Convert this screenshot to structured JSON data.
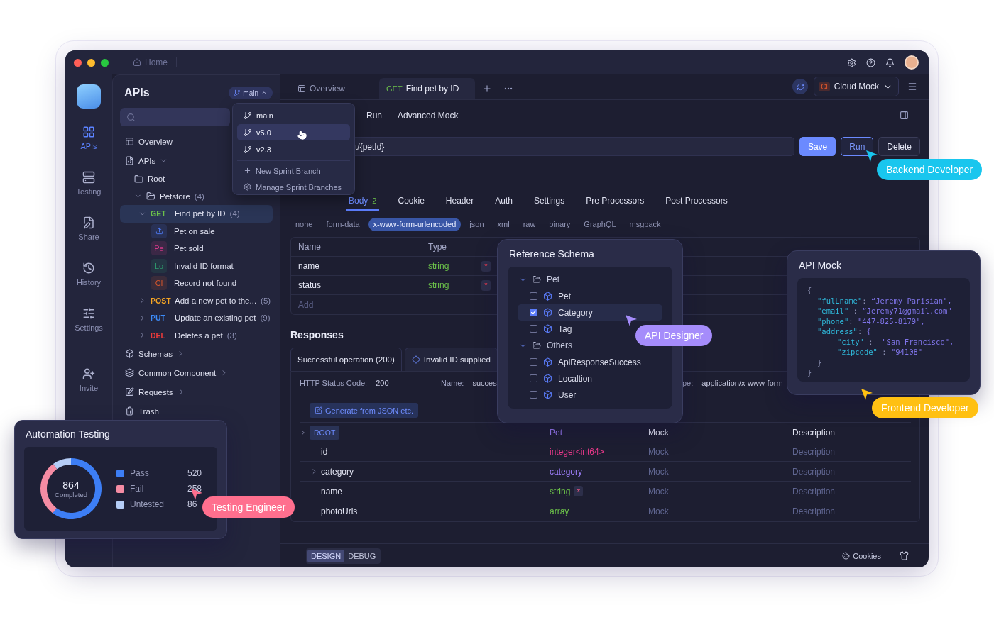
{
  "window": {
    "home": "Home"
  },
  "rail": {
    "items": [
      {
        "label": "APIs",
        "selected": true
      },
      {
        "label": "Testing",
        "selected": false
      },
      {
        "label": "Share",
        "selected": false
      },
      {
        "label": "History",
        "selected": false
      },
      {
        "label": "Settings",
        "selected": false
      }
    ],
    "invite": "Invite"
  },
  "tree": {
    "title": "APIs",
    "branch": {
      "label": "main",
      "expanded": true
    },
    "sections": [
      {
        "kind": "section",
        "label": "Overview"
      },
      {
        "kind": "section",
        "label": "APIs",
        "expanded": true,
        "children": [
          {
            "kind": "folder",
            "label": "Root"
          },
          {
            "kind": "folder",
            "label": "Petstore",
            "count": "(4)",
            "expanded": true,
            "children": [
              {
                "kind": "endpoint",
                "method": "GET",
                "color": "#6cc24a",
                "label": "Find pet by ID",
                "count": "(4)",
                "expanded": true,
                "selected": true,
                "children": [
                  {
                    "kind": "case",
                    "label": "Pet on sale",
                    "color": "#4f7cf7",
                    "selected": false
                  },
                  {
                    "kind": "case",
                    "badge": "Pe",
                    "label": "Pet sold",
                    "color": "#d63a8a",
                    "selected": false
                  },
                  {
                    "kind": "case",
                    "badge": "Lo",
                    "label": "Invalid ID format",
                    "color": "#2f9e6e",
                    "selected": false
                  },
                  {
                    "kind": "case",
                    "badge": "Cl",
                    "label": "Record not found",
                    "color": "#d9572b",
                    "selected": false
                  }
                ]
              },
              {
                "kind": "endpoint",
                "method": "POST",
                "color": "#f5a524",
                "label": "Add a new pet to the...",
                "count": "(5)",
                "expanded": false,
                "selected": false
              },
              {
                "kind": "endpoint",
                "method": "PUT",
                "color": "#3d8bf7",
                "label": "Update an existing pet",
                "count": "(9)",
                "expanded": false,
                "selected": false
              },
              {
                "kind": "endpoint",
                "method": "DEL",
                "color": "#ef3b3b",
                "label": "Deletes a pet",
                "count": "(3)",
                "expanded": false,
                "selected": false
              }
            ]
          }
        ]
      },
      {
        "kind": "section",
        "label": "Schemas",
        "expanded": false
      },
      {
        "kind": "section",
        "label": "Common Component",
        "expanded": false
      },
      {
        "kind": "section",
        "label": "Requests",
        "expanded": false
      },
      {
        "kind": "section",
        "label": "Trash"
      }
    ]
  },
  "branch_menu": {
    "branches": [
      {
        "label": "main",
        "selected": false
      },
      {
        "label": "v5.0",
        "selected": true
      },
      {
        "label": "v2.3",
        "selected": false
      }
    ],
    "actions": [
      "New Sprint Branch",
      "Manage Sprint Branches"
    ]
  },
  "tabs": [
    {
      "label": "Overview",
      "selected": false
    },
    {
      "method": "GET",
      "label": "Find pet by ID",
      "selected": true
    }
  ],
  "environment": {
    "badge": "Cl",
    "label": "Cloud Mock"
  },
  "subtabs": [
    "Run",
    "Advanced Mock"
  ],
  "url": {
    "value": "t/{petId}"
  },
  "actions": [
    {
      "label": "Save",
      "kind": "primary"
    },
    {
      "label": "Run",
      "kind": "outline"
    },
    {
      "label": "Delete",
      "kind": "plain"
    }
  ],
  "request_tabs": [
    {
      "label": "Body",
      "count": "2",
      "selected": true
    },
    {
      "label": "Cookie",
      "selected": false
    },
    {
      "label": "Header",
      "selected": false
    },
    {
      "label": "Auth",
      "selected": false
    },
    {
      "label": "Settings",
      "selected": false
    },
    {
      "label": "Pre Processors",
      "selected": false
    },
    {
      "label": "Post Processors",
      "selected": false
    }
  ],
  "body_types": [
    {
      "label": "none",
      "selected": false
    },
    {
      "label": "form-data",
      "selected": false
    },
    {
      "label": "x-www-form-urlencoded",
      "selected": true
    },
    {
      "label": "json",
      "selected": false
    },
    {
      "label": "xml",
      "selected": false
    },
    {
      "label": "raw",
      "selected": false
    },
    {
      "label": "binary",
      "selected": false
    },
    {
      "label": "GraphQL",
      "selected": false
    },
    {
      "label": "msgpack",
      "selected": false
    }
  ],
  "params": {
    "columns": [
      "Name",
      "Type"
    ],
    "rows": [
      {
        "name": "name",
        "type": "string",
        "required_mark": "*"
      },
      {
        "name": "status",
        "type": "string",
        "required_mark": "*"
      }
    ],
    "add": "Add"
  },
  "responses": {
    "title": "Responses",
    "tabs": [
      {
        "label": "Successful operation (200)",
        "selected": true
      },
      {
        "label": "Invalid ID supplied",
        "selected": false
      }
    ],
    "info": [
      {
        "label": "HTTP Status Code:",
        "value": "200"
      },
      {
        "label": "Name:",
        "value": "succes"
      },
      {
        "label": "pe:",
        "value": "application/x-www-form"
      }
    ],
    "generate": "Generate from JSON etc.",
    "schema": {
      "root": "ROOT",
      "root_type": "Pet",
      "columns": [
        "Mock",
        "Description"
      ],
      "rows": [
        {
          "name": "id",
          "type": "integer<int64>",
          "color": "#e8398a",
          "mock": "Mock",
          "description": "Description"
        },
        {
          "name": "category",
          "type": "category",
          "color": "#9b7cf6",
          "expanded": false,
          "mock": "Mock",
          "description": "Description"
        },
        {
          "name": "name",
          "type": "string",
          "color": "#6cc24a",
          "required_mark": "*",
          "mock": "Mock",
          "description": "Description"
        },
        {
          "name": "photoUrls",
          "type": "array",
          "color": "#6cc24a",
          "mock": "Mock",
          "description": "Description"
        }
      ]
    }
  },
  "bottom": {
    "modes": [
      {
        "label": "DESIGN",
        "selected": true
      },
      {
        "label": "DEBUG",
        "selected": false
      }
    ],
    "cookies": "Cookies"
  },
  "reference_schema": {
    "title": "Reference Schema",
    "groups": [
      {
        "label": "Pet",
        "expanded": true,
        "items": [
          {
            "label": "Pet",
            "checked": false
          },
          {
            "label": "Category",
            "checked": true
          },
          {
            "label": "Tag",
            "checked": false
          }
        ]
      },
      {
        "label": "Others",
        "expanded": true,
        "items": [
          {
            "label": "ApiResponseSuccess",
            "checked": false
          },
          {
            "label": "Localtion",
            "checked": false
          },
          {
            "label": "User",
            "checked": false
          }
        ]
      }
    ]
  },
  "api_mock": {
    "title": "API Mock",
    "open": "{",
    "entries": [
      {
        "key": "\"fulLname\"",
        "sep": ": ",
        "value": "“Jeremy Parisian\","
      },
      {
        "key": "\"email\"",
        "sep": " : ",
        "value": "“Jeremy71@gmail.com\""
      },
      {
        "key": "\"phone\"",
        "sep": ": ",
        "value": "\"447-825-8179\","
      },
      {
        "key": "\"address\"",
        "sep": ": ",
        "value": "{",
        "close": "}",
        "children": [
          {
            "key": "\"city\"",
            "sep": " :  ",
            "value": "\"San Francisco\","
          },
          {
            "key": "\"zipcode\"",
            "sep": " : ",
            "value": "\"94108\""
          }
        ]
      }
    ],
    "close": "}"
  },
  "automation": {
    "title": "Automation Testing",
    "total": "864",
    "total_label": "Completed",
    "legend": [
      {
        "value": "520",
        "color": "#3d7ef5"
      },
      {
        "value": "258",
        "color": "#f58ca4"
      },
      {
        "value": "86",
        "color": "#b5cdf7"
      }
    ],
    "chart_data": {
      "type": "donut",
      "categories": [
        "Pass",
        "Fail",
        "Untested"
      ],
      "values": [
        60.2,
        29.9,
        9.9
      ]
    }
  },
  "roles": [
    {
      "label": "Backend Developer",
      "color": "#19c6ee"
    },
    {
      "label": "API Designer",
      "color": "#a58cfb"
    },
    {
      "label": "Frontend Developer",
      "color": "#ffc012"
    },
    {
      "label": "Testing Engineer",
      "color": "#ff6f8e"
    }
  ]
}
